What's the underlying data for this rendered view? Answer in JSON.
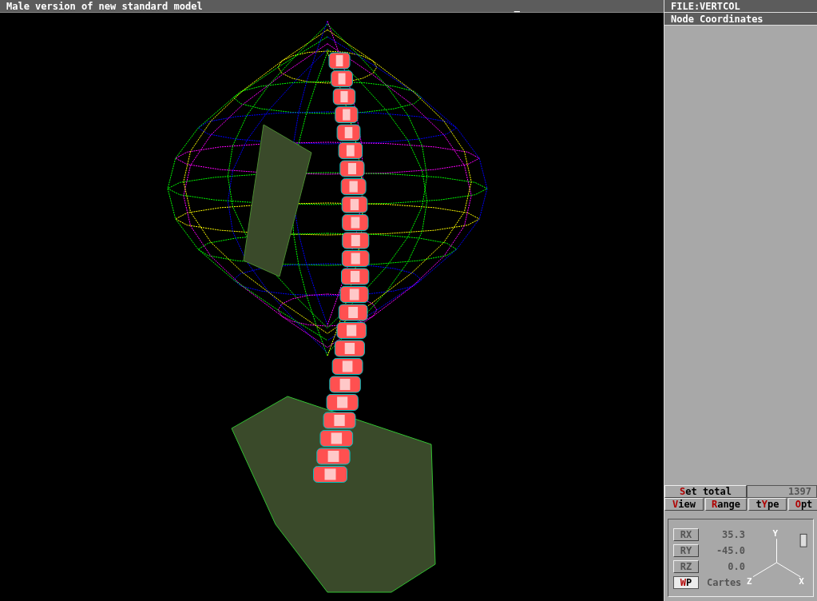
{
  "window": {
    "title": "Male version of new standard model",
    "cursor": "_"
  },
  "side_panel": {
    "file": "FILE:VERTCOL",
    "title": "Node Coordinates"
  },
  "set_total": {
    "button": {
      "key": "S",
      "tail": "et total"
    },
    "value": "1397"
  },
  "menu": [
    {
      "key": "V",
      "tail": "iew"
    },
    {
      "key": "R",
      "tail": "ange"
    },
    {
      "lead": "t",
      "key": "Y",
      "tail": "pe"
    },
    {
      "key": "O",
      "tail": "pt"
    }
  ],
  "view_rows": [
    {
      "tail": "RX",
      "value": "35.3",
      "selected": false
    },
    {
      "tail": "RY",
      "value": "-45.0",
      "selected": false
    },
    {
      "tail": "RZ",
      "value": "0.0",
      "selected": false
    },
    {
      "key": "W",
      "tail": "P",
      "value": "Cartes",
      "selected": true
    }
  ],
  "axes": {
    "y": "Y",
    "z": "Z",
    "x": "X"
  }
}
